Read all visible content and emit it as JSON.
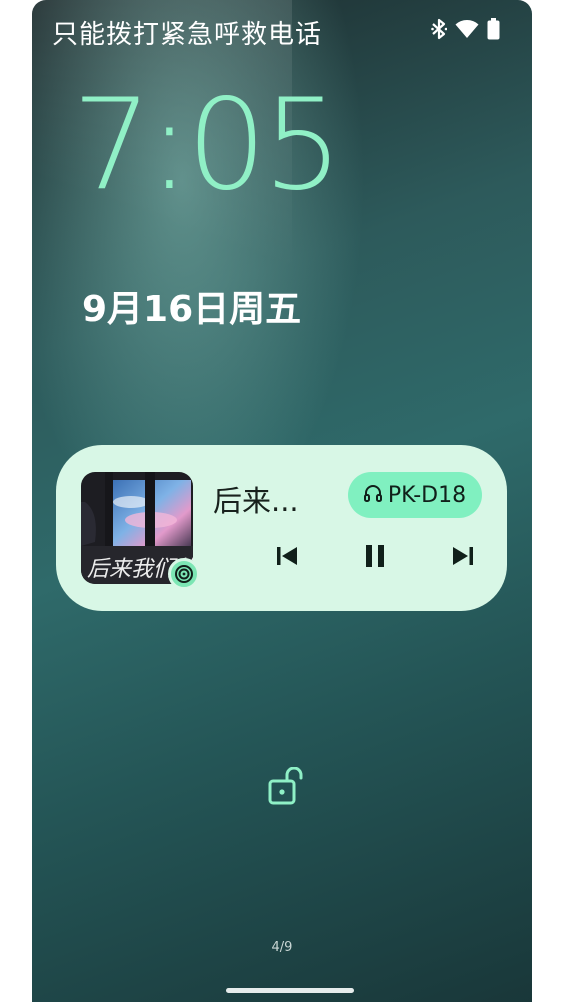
{
  "status_bar": {
    "emergency_text": "只能拨打紧急呼救电话",
    "icons": [
      "bluetooth-icon",
      "wifi-icon",
      "battery-icon"
    ]
  },
  "lock_screen": {
    "time": "7:05",
    "date": "9月16日周五",
    "page_indicator": "4/9"
  },
  "media_player": {
    "song_title": "后来...",
    "output_device": "PK-D18",
    "album_art_text": "后来我们的爱",
    "controls": [
      "previous-icon",
      "pause-icon",
      "next-icon"
    ]
  },
  "colors": {
    "accent": "#90f0c6",
    "card_bg": "#d8f7e6",
    "pill_bg": "#80f0c0"
  }
}
